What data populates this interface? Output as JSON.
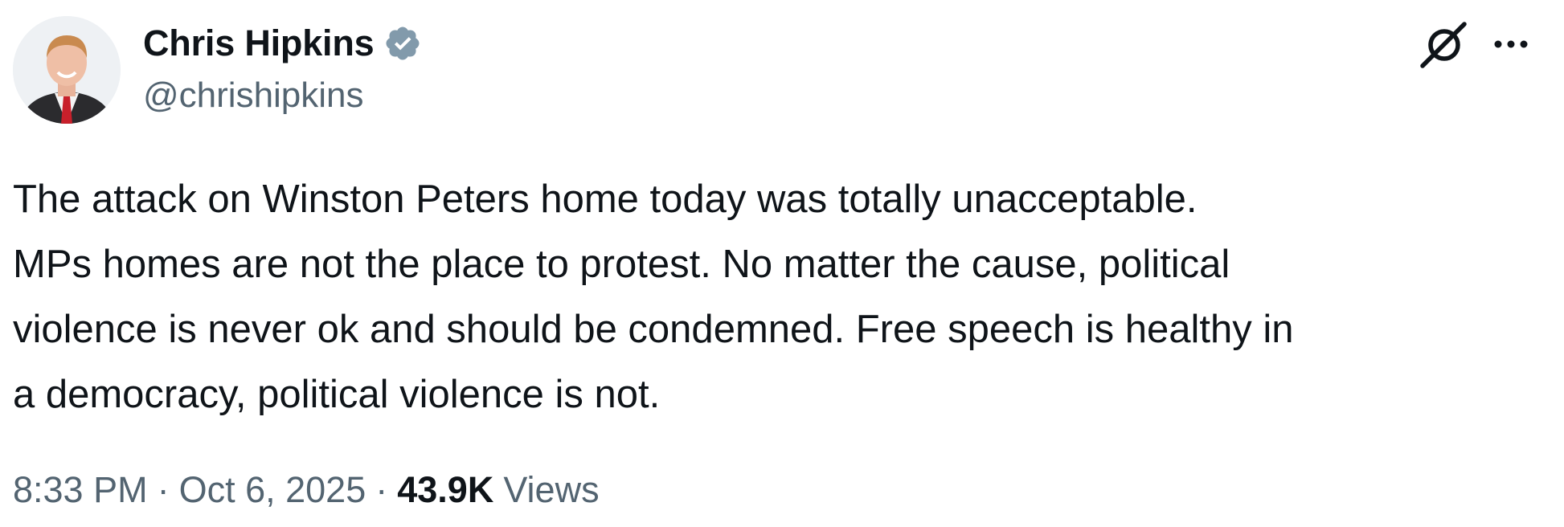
{
  "author": {
    "name": "Chris Hipkins",
    "handle": "@chrishipkins",
    "verified_icon": "verified-badge-icon",
    "badge_color": "#829aab"
  },
  "actions": {
    "grok_icon": "grok-slash-circle-icon",
    "more_icon": "more-dots-icon"
  },
  "tweet": {
    "lines": [
      "The attack on Winston Peters home today was totally unacceptable.",
      "MPs homes are not the place to protest. No matter the cause, political",
      "violence is never ok and should be condemned. Free speech is healthy in",
      "a democracy, political violence is not."
    ]
  },
  "meta": {
    "time": "8:33 PM",
    "separator": "·",
    "date": "Oct 6, 2025",
    "views_count": "43.9K",
    "views_label": "Views"
  },
  "colors": {
    "text_primary": "#0f1419",
    "text_secondary": "#536471",
    "background": "#ffffff"
  }
}
